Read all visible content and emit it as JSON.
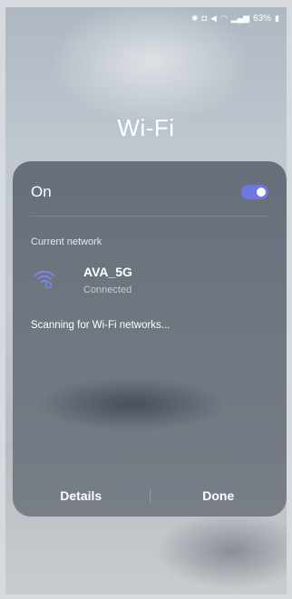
{
  "status_bar": {
    "battery": "63%",
    "icons": [
      "bluetooth-icon",
      "nfc-icon",
      "mute-icon",
      "wifi-icon",
      "signal-icon",
      "battery-icon"
    ]
  },
  "page": {
    "title": "Wi-Fi"
  },
  "panel": {
    "toggle_label": "On",
    "toggle_on": true,
    "current_network_label": "Current network",
    "network": {
      "name": "AVA_5G",
      "status": "Connected"
    },
    "scanning_text": "Scanning for Wi-Fi networks...",
    "buttons": {
      "details": "Details",
      "done": "Done"
    }
  },
  "colors": {
    "accent": "#6e78e0",
    "text": "#ffffff"
  }
}
